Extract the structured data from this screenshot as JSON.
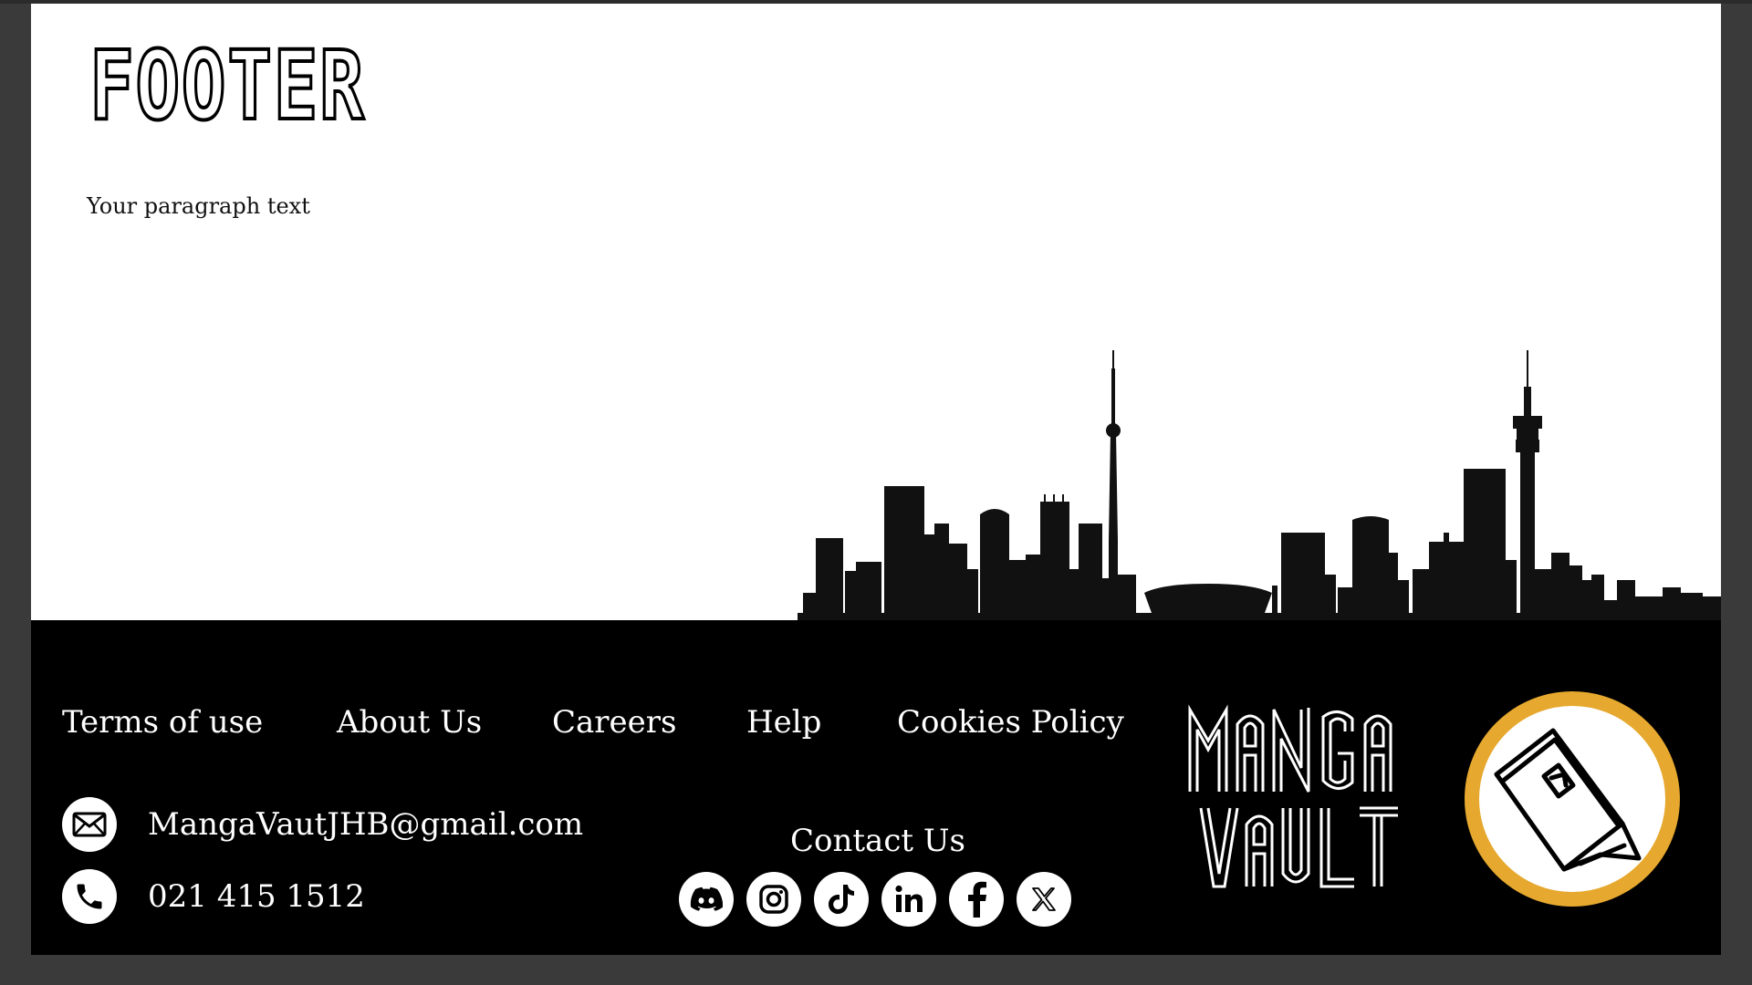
{
  "page": {
    "heading": "FOOTER",
    "paragraph": "Your paragraph text"
  },
  "footer": {
    "nav": [
      {
        "label": "Terms of use"
      },
      {
        "label": "About Us"
      },
      {
        "label": "Careers"
      },
      {
        "label": "Help"
      },
      {
        "label": "Cookies Policy"
      }
    ],
    "email": "MangaVautJHB@gmail.com",
    "phone": "021 415 1512",
    "contact_heading": "Contact Us",
    "socials": [
      {
        "name": "discord-icon"
      },
      {
        "name": "instagram-icon"
      },
      {
        "name": "tiktok-icon"
      },
      {
        "name": "linkedin-icon"
      },
      {
        "name": "facebook-icon"
      },
      {
        "name": "x-icon"
      }
    ],
    "logo": {
      "line1": "MANGA",
      "line2": "VAULT",
      "ring_color": "#E6A82E"
    }
  },
  "colors": {
    "footer_bg": "#000000",
    "page_bg": "#ffffff",
    "frame": "#3a3a3a"
  }
}
